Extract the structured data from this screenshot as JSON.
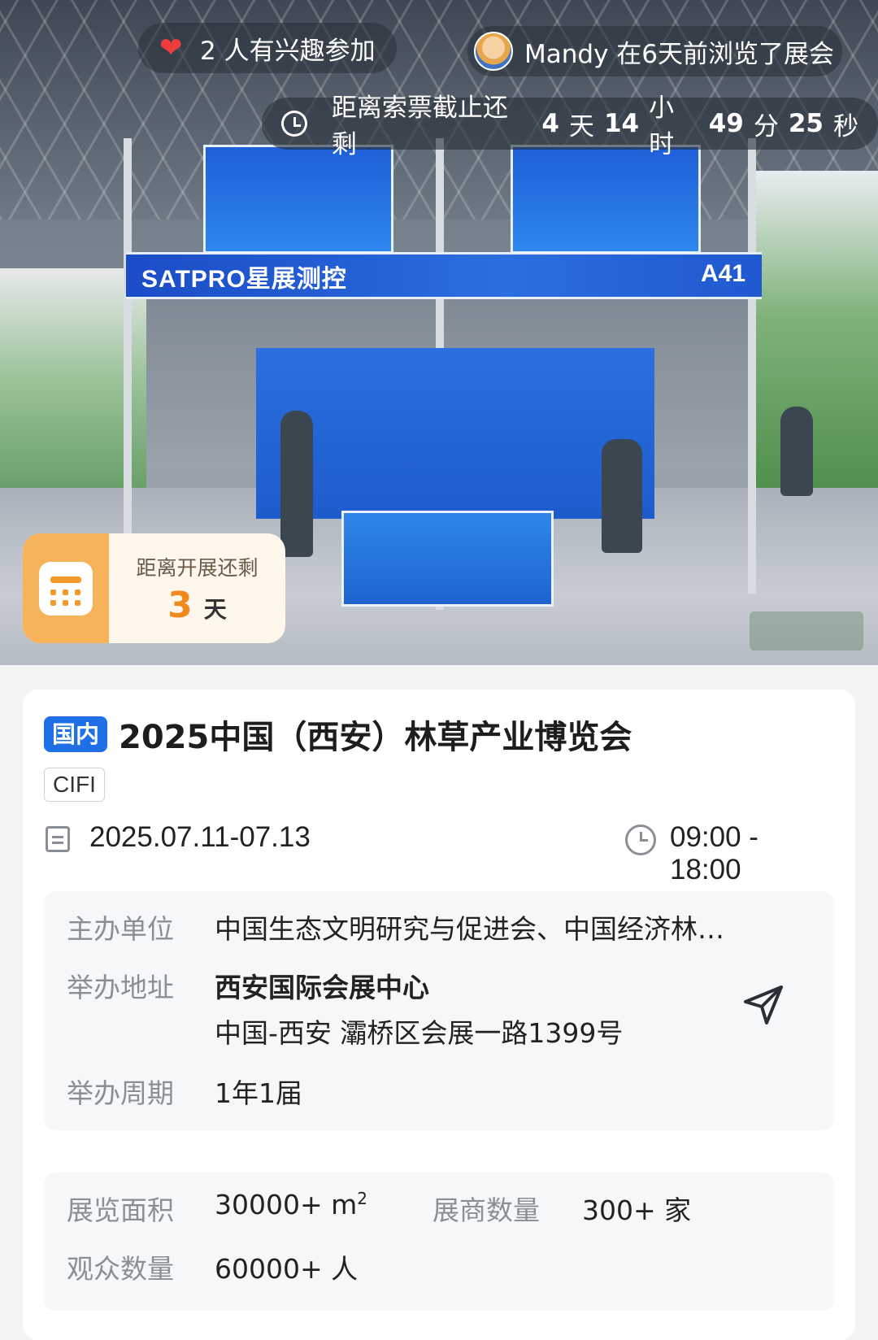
{
  "hero": {
    "interest_text": "2 人有兴趣参加",
    "viewer_text": "Mandy 在6天前浏览了展会",
    "deadline_prefix": "距离索票截止还剩",
    "deadline_days": "4",
    "deadline_days_unit": "天",
    "deadline_hours": "14",
    "deadline_hours_unit": "小时",
    "deadline_minutes": "49",
    "deadline_minutes_unit": "分",
    "deadline_seconds": "25",
    "deadline_seconds_unit": "秒",
    "photo_strip_brand": "SATPRO星展测控",
    "photo_strip_booth": "A41",
    "open_label": "距离开展还剩",
    "open_days": "3",
    "open_unit": "天"
  },
  "expo": {
    "tag": "国内",
    "title": "2025中国（西安）林草产业博览会",
    "abbr": "CIFI",
    "date": "2025.07.11-07.13",
    "time": "09:00 - 18:00"
  },
  "info": {
    "organizer_label": "主办单位",
    "organizer_value": "中国生态文明研究与促进会、中国经济林…",
    "address_label": "举办地址",
    "venue_name": "西安国际会展中心",
    "venue_address": "中国-西安 灞桥区会展一路1399号",
    "cycle_label": "举办周期",
    "cycle_value": "1年1届"
  },
  "stats": {
    "area_label": "展览面积",
    "area_value": "30000+ m",
    "area_sup": "2",
    "exhibitors_label": "展商数量",
    "exhibitors_value": "300+ 家",
    "visitors_label": "观众数量",
    "visitors_value": "60000+ 人"
  },
  "colors": {
    "accent_blue": "#1f6fe6",
    "countdown_orange": "#f08a1c",
    "heart_red": "#ef3b3b"
  },
  "icons": [
    "heart-icon",
    "avatar",
    "clock-icon",
    "calendar-icon",
    "navigation-icon"
  ]
}
